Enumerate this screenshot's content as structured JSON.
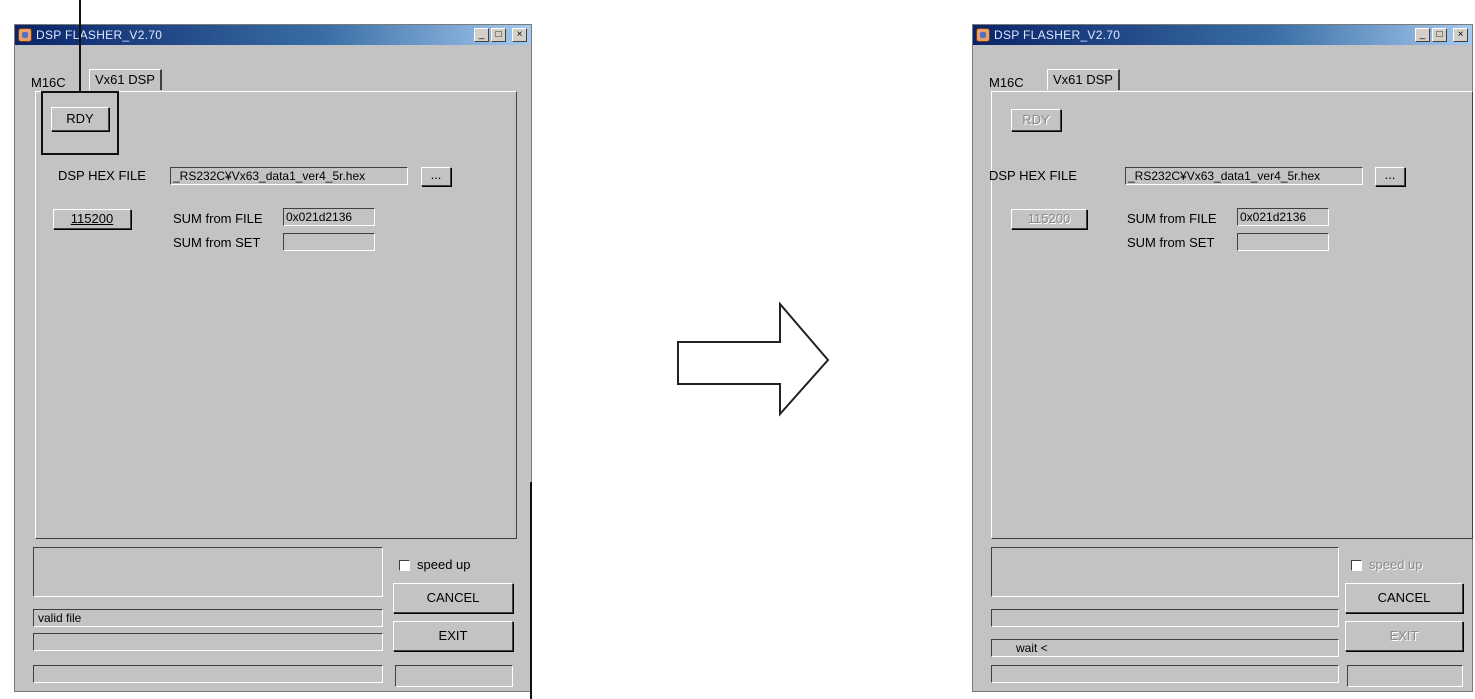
{
  "left_window": {
    "title": "DSP FLASHER_V2.70",
    "tabs": [
      "M16C",
      "Vx61 DSP"
    ],
    "rdy_button": "RDY",
    "dsp_hex_label": "DSP HEX FILE",
    "dsp_hex_value": "_RS232C¥Vx63_data1_ver4_5r.hex",
    "browse_button": "...",
    "baud_button": "115200",
    "sum_file_label": "SUM from FILE",
    "sum_file_value": "0x021d2136",
    "sum_set_label": "SUM from SET",
    "sum_set_value": "",
    "speed_up_label": "speed up",
    "cancel_button": "CANCEL",
    "exit_button": "EXIT",
    "status_lines": [
      "",
      "valid file",
      "",
      ""
    ]
  },
  "right_window": {
    "title": "DSP FLASHER_V2.70",
    "tabs": [
      "M16C",
      "Vx61 DSP"
    ],
    "rdy_button": "RDY",
    "dsp_hex_label": "DSP HEX FILE",
    "dsp_hex_value": "_RS232C¥Vx63_data1_ver4_5r.hex",
    "browse_button": "...",
    "baud_button": "115200",
    "sum_file_label": "SUM from FILE",
    "sum_file_value": "0x021d2136",
    "sum_set_label": "SUM from SET",
    "sum_set_value": "",
    "speed_up_label": "speed up",
    "cancel_button": "CANCEL",
    "exit_button": "EXIT",
    "status_lines": [
      "",
      "",
      "wait <",
      ""
    ]
  },
  "icons": {
    "arrow": "right-arrow-outline-icon",
    "app": "dsp-flasher-app-icon"
  }
}
